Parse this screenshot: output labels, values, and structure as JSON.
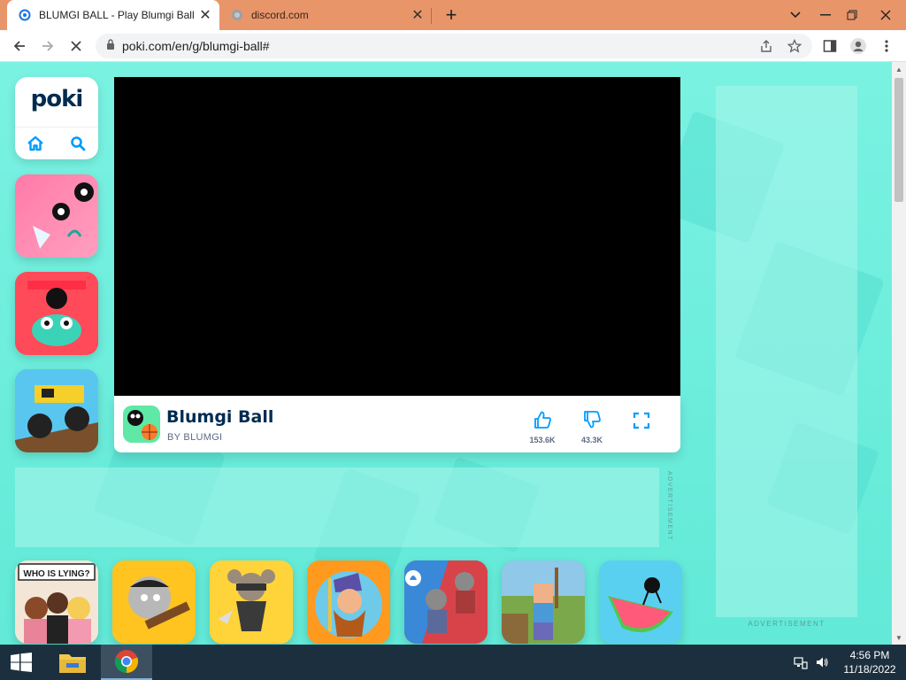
{
  "browser": {
    "tabs": [
      {
        "title": "BLUMGI BALL - Play Blumgi Ball o",
        "active": true,
        "favicon": "poki-icon"
      },
      {
        "title": "discord.com",
        "active": false,
        "favicon": "globe-icon"
      }
    ],
    "url": "poki.com/en/g/blumgi-ball#"
  },
  "sidebar": {
    "logo": "poki",
    "home_icon": "home-icon",
    "search_icon": "search-icon"
  },
  "game": {
    "title": "Blumgi Ball",
    "author": "BY BLUMGI",
    "likes": "153.6K",
    "dislikes": "43.3K"
  },
  "ads": {
    "bottom_label": "ADVERTISEMENT",
    "side_label": "ADVERTISEMENT"
  },
  "bottom_games": [
    {
      "badge": "WHO IS LYING?"
    },
    {},
    {},
    {},
    {},
    {},
    {}
  ],
  "taskbar": {
    "time": "4:56 PM",
    "date": "11/18/2022"
  },
  "colors": {
    "tab_bar": "#e8956a",
    "page_bg": "#62e9d7",
    "poki_blue": "#002b50",
    "accent_blue": "#009cff"
  }
}
